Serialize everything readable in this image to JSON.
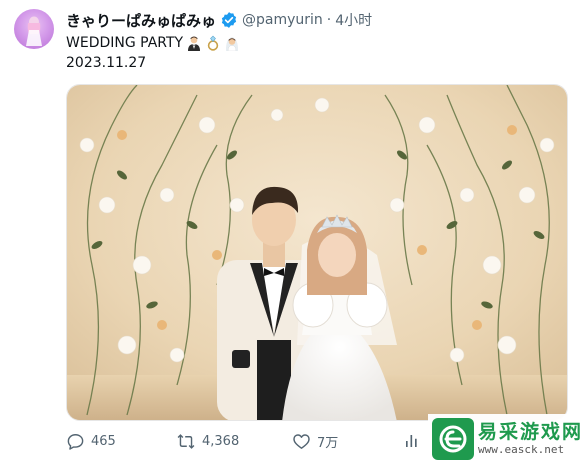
{
  "author": {
    "display_name": "きゃりーぱみゅぱみゅ",
    "handle": "@pamyurin",
    "separator": "·",
    "time_ago": "4小时",
    "avatar_icon": "avatar-pink-figure",
    "verified_icon": "verified-badge-icon",
    "verified_color": "#1d9bf0"
  },
  "tweet": {
    "text": "WEDDING PARTY",
    "emojis": [
      "man-in-tuxedo",
      "ring",
      "bride-with-veil"
    ],
    "date_line": "2023.11.27"
  },
  "photo": {
    "alt_subject": "wedding-photo-couple-with-floral-backdrop"
  },
  "actions": {
    "reply": {
      "icon": "reply-icon",
      "count": "465"
    },
    "retweet": {
      "icon": "retweet-icon",
      "count": "4,368"
    },
    "like": {
      "icon": "heart-icon",
      "count": "7万"
    },
    "views": {
      "icon": "views-chart-icon"
    }
  },
  "watermark": {
    "logo_icon": "e-logo-icon",
    "text_cn": "易采游戏网",
    "url": "www.easck.net",
    "color": "#1f9a4e"
  },
  "colors": {
    "text_primary": "#0f1419",
    "text_secondary": "#536471"
  }
}
